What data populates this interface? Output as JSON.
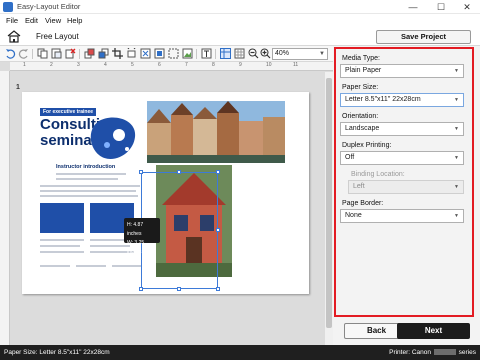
{
  "window": {
    "title": "Easy-Layout Editor",
    "minimize": "—",
    "maximize": "☐",
    "close": "✕"
  },
  "menu": {
    "items": [
      "File",
      "Edit",
      "View",
      "Help"
    ]
  },
  "layout": {
    "title": "Free Layout",
    "save_label": "Save Project"
  },
  "toolbar": {
    "icons": [
      "undo-icon",
      "redo-icon",
      "copy-icon",
      "paste-icon",
      "delete-icon",
      "bring-forward-icon",
      "crop-icon",
      "fit-icon",
      "fill-icon",
      "grid-icon",
      "align-icon",
      "zoom-out-icon",
      "zoom-in-icon"
    ],
    "zoom_value": "40%"
  },
  "canvas": {
    "page_number": "1",
    "ruler_top": [
      "1",
      "2",
      "3",
      "4",
      "5",
      "6",
      "7",
      "8",
      "9",
      "10",
      "11"
    ]
  },
  "flyer": {
    "tag": "For executive trainee",
    "title_line1": "Consulting",
    "title_line2": "seminar",
    "instructor": "Instructor introduction",
    "size_tip_h": "H: 4.87 inches",
    "size_tip_w": "W: 3.25 inches"
  },
  "settings": {
    "media_type_label": "Media Type:",
    "media_type_value": "Plain Paper",
    "paper_size_label": "Paper Size:",
    "paper_size_value": "Letter 8.5\"x11\" 22x28cm",
    "orientation_label": "Orientation:",
    "orientation_value": "Landscape",
    "duplex_label": "Duplex Printing:",
    "duplex_value": "Off",
    "binding_label": "Binding Location:",
    "binding_value": "Left",
    "border_label": "Page Border:",
    "border_value": "None"
  },
  "nav": {
    "back_label": "Back",
    "next_label": "Next"
  },
  "status": {
    "paper_size": "Paper Size: Letter 8.5\"x11\" 22x28cm",
    "printer_prefix": "Printer: Canon",
    "printer_suffix": "series"
  },
  "colors": {
    "accent_red": "#e31b23",
    "next_button": "#1c1c1c",
    "status_bar": "#1f1f1f",
    "selection_blue": "#3d7ad8"
  }
}
